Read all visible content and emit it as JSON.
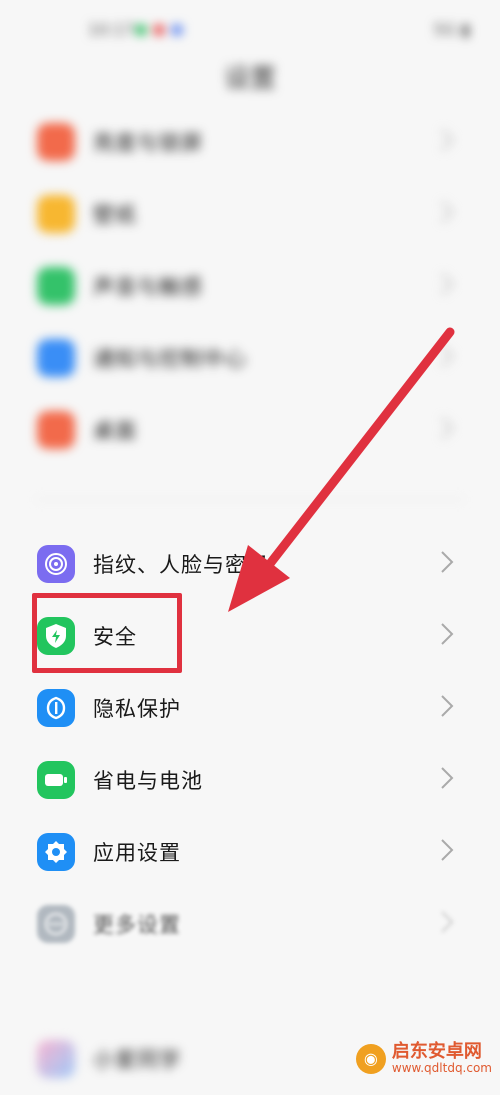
{
  "status_bar": {
    "time": "10:17",
    "right_text": "5G  ▮"
  },
  "header": {
    "title": "设置"
  },
  "group_top": {
    "items": [
      {
        "label": "亮度与锁屏",
        "icon": "brightness-icon",
        "color": "#f26a4b"
      },
      {
        "label": "壁纸",
        "icon": "wallpaper-icon",
        "color": "#f7b731"
      },
      {
        "label": "声音与触感",
        "icon": "sound-icon",
        "color": "#34c26a"
      },
      {
        "label": "通知与控制中心",
        "icon": "notification-icon",
        "color": "#3a8ef6"
      },
      {
        "label": "桌面",
        "icon": "desktop-icon",
        "color": "#f26a4b"
      }
    ]
  },
  "group_main": {
    "items": [
      {
        "label": "指纹、人脸与密码",
        "icon": "fingerprint-icon",
        "color": "#7b6cf0"
      },
      {
        "label": "安全",
        "icon": "shield-bolt-icon",
        "color": "#22c55e"
      },
      {
        "label": "隐私保护",
        "icon": "privacy-icon",
        "color": "#1f8ff5"
      },
      {
        "label": "省电与电池",
        "icon": "battery-icon",
        "color": "#22c55e"
      },
      {
        "label": "应用设置",
        "icon": "gear-icon",
        "color": "#1f8ff5"
      },
      {
        "label": "更多设置",
        "icon": "more-icon",
        "color": "#9aa4ae"
      }
    ]
  },
  "bottom": {
    "label": "小爱同学"
  },
  "annotation": {
    "color": "#e0313f"
  },
  "watermark": {
    "name": "启东安卓网",
    "url": "www.qdltdq.com"
  }
}
